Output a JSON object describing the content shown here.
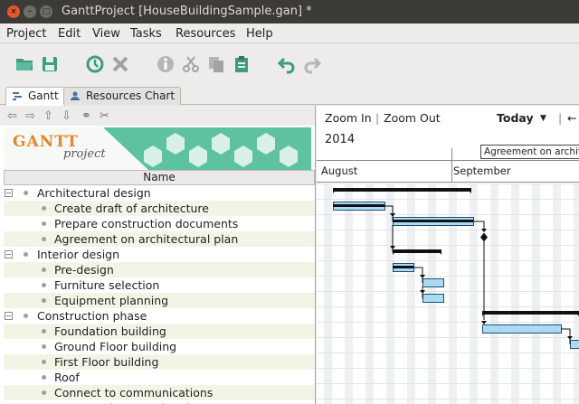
{
  "window": {
    "title": "GanttProject [HouseBuildingSample.gan] *"
  },
  "menu": [
    "Project",
    "Edit",
    "View",
    "Tasks",
    "Resources",
    "Help"
  ],
  "toolbar": {
    "icons": [
      "open-folder-icon",
      "save-icon",
      "history-icon",
      "delete-icon",
      "info-icon",
      "cut-icon",
      "copy-icon",
      "paste-icon",
      "undo-icon",
      "redo-icon"
    ]
  },
  "tabs": [
    {
      "label": "Gantt",
      "active": true
    },
    {
      "label": "Resources Chart",
      "active": false
    }
  ],
  "tree": {
    "column_name": "Name",
    "logo_text": "GANTT",
    "logo_sub": "project",
    "rows": [
      {
        "label": "Architectural design",
        "level": 0,
        "group": true
      },
      {
        "label": "Create draft of architecture",
        "level": 1
      },
      {
        "label": "Prepare construction documents",
        "level": 1
      },
      {
        "label": "Agreement on architectural plan",
        "level": 1
      },
      {
        "label": "Interior design",
        "level": 0,
        "group": true
      },
      {
        "label": "Pre-design",
        "level": 1
      },
      {
        "label": "Furniture selection",
        "level": 1
      },
      {
        "label": "Equipment planning",
        "level": 1
      },
      {
        "label": "Construction phase",
        "level": 0,
        "group": true
      },
      {
        "label": "Foundation building",
        "level": 1
      },
      {
        "label": "Ground Floor building",
        "level": 1
      },
      {
        "label": "First Floor building",
        "level": 1
      },
      {
        "label": "Roof",
        "level": 1
      },
      {
        "label": "Connect to communications",
        "level": 1
      },
      {
        "label": "Construction completed",
        "level": 1
      }
    ]
  },
  "chart": {
    "zoom_in": "Zoom In",
    "zoom_out": "Zoom Out",
    "today": "Today",
    "year": "2014",
    "months": [
      "August",
      "September"
    ],
    "milestone_label": "Agreement on architect",
    "separator": "|",
    "arrow_left": "←",
    "today_arrow": "▼"
  },
  "colors": {
    "bar_fill": "#a9dcf2",
    "bar_border": "#1f4e79",
    "group_bar": "#111111",
    "row_alt": "#f2f5e6",
    "weekend_col": "#eef1f3"
  }
}
